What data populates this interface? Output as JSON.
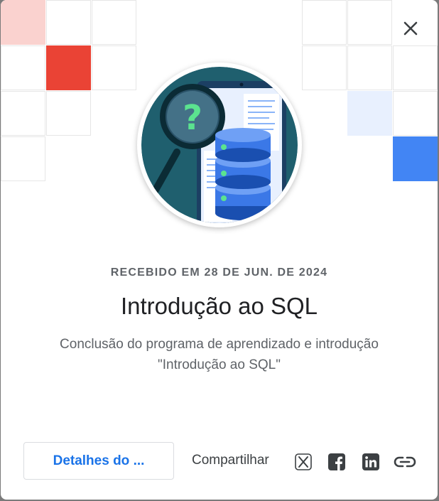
{
  "dialog": {
    "close_icon": "close-icon",
    "received_date": "RECEBIDO EM 28 DE JUN. DE 2024",
    "title": "Introdução ao SQL",
    "description": "Conclusão do programa de aprendizado e introdução \"Introdução ao SQL\"",
    "details_button": "Detalhes do ...",
    "share_label": "Compartilhar",
    "share_icons": [
      "x-icon",
      "facebook-icon",
      "linkedin-icon",
      "link-icon"
    ]
  },
  "colors": {
    "accent_red": "#ea4335",
    "light_red": "#fad2cf",
    "accent_blue": "#4285f4",
    "light_blue": "#e8f0fe",
    "link_blue": "#1a73e8",
    "badge_teal": "#1f5f6e"
  }
}
